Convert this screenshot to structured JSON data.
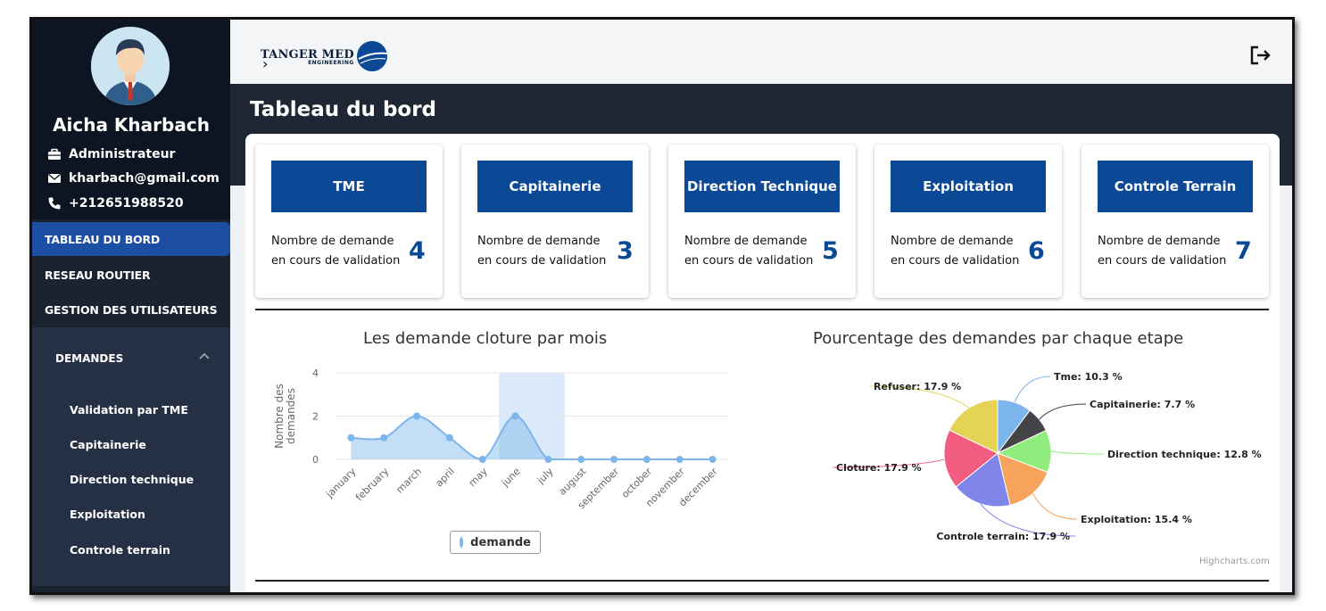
{
  "user": {
    "name": "Aicha Kharbach",
    "role": "Administrateur",
    "email": "kharbach@gmail.com",
    "phone": "+212651988520"
  },
  "nav": {
    "items": [
      {
        "label": "TABLEAU DU BORD",
        "active": true
      },
      {
        "label": "RESEAU ROUTIER",
        "active": false
      },
      {
        "label": "GESTION DES UTILISATEURS",
        "active": false
      }
    ],
    "demandes": {
      "label": "DEMANDES",
      "items": [
        "Validation par TME",
        "Capitainerie",
        "Direction technique",
        "Exploitation",
        "Controle terrain"
      ]
    }
  },
  "header": {
    "logo_top": "TANGER MED",
    "logo_sub": "ENGINEERING",
    "page_title": "Tableau du bord"
  },
  "cards": [
    {
      "title": "TME",
      "line1": "Nombre de demande",
      "line2": "en cours de validation",
      "count": "4"
    },
    {
      "title": "Capitainerie",
      "line1": "Nombre de demande",
      "line2": "en cours de validation",
      "count": "3"
    },
    {
      "title": "Direction Technique",
      "line1": "Nombre de demande",
      "line2": "en cours de validation",
      "count": "5"
    },
    {
      "title": "Exploitation",
      "line1": "Nombre de demande",
      "line2": "en cours de validation",
      "count": "6"
    },
    {
      "title": "Controle Terrain",
      "line1": "Nombre de demande",
      "line2": "en cours de validation",
      "count": "7"
    }
  ],
  "colors": {
    "sidebar": "#1b2331",
    "accent": "#0b4896",
    "active_nav": "#1c4ea3",
    "series": "#7cb5ec"
  },
  "chart_data": [
    {
      "type": "area",
      "title": "Les demande cloture par mois",
      "ylabel": "Nombre des demandes",
      "xlabel": "",
      "categories": [
        "january",
        "february",
        "march",
        "april",
        "may",
        "june",
        "july",
        "august",
        "september",
        "october",
        "november",
        "december"
      ],
      "series": [
        {
          "name": "demande",
          "values": [
            1,
            1,
            2,
            1,
            0,
            2,
            0,
            0,
            0,
            0,
            0,
            0
          ]
        }
      ],
      "ylim": [
        0,
        4
      ],
      "yticks": [
        0,
        2,
        4
      ],
      "highlighted_category": "june",
      "legend": "bottom-center",
      "grid": true
    },
    {
      "type": "pie",
      "title": "Pourcentage des demandes par chaque etape",
      "slices": [
        {
          "label": "Tme",
          "value": 10.3,
          "color": "#7cb5ec"
        },
        {
          "label": "Capitainerie",
          "value": 7.7,
          "color": "#434348"
        },
        {
          "label": "Direction technique",
          "value": 12.8,
          "color": "#90ed7d"
        },
        {
          "label": "Exploitation",
          "value": 15.4,
          "color": "#f7a35c"
        },
        {
          "label": "Controle terrain",
          "value": 17.9,
          "color": "#8085e9"
        },
        {
          "label": "Cloture",
          "value": 17.9,
          "color": "#f15c80"
        },
        {
          "label": "Refuser",
          "value": 17.9,
          "color": "#e4d354"
        }
      ],
      "credit": "Highcharts.com"
    }
  ]
}
